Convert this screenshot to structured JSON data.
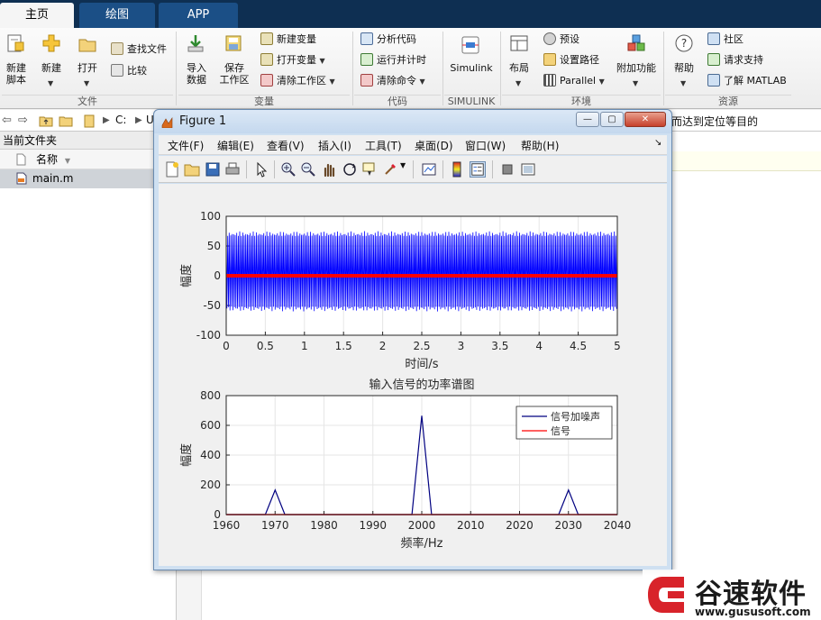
{
  "tabs": [
    {
      "label": "主页",
      "active": true
    },
    {
      "label": "绘图",
      "active": false
    },
    {
      "label": "APP",
      "active": false
    }
  ],
  "ribbon": {
    "file": {
      "new_script": "新建\n脚本",
      "new": "新建",
      "open": "打开",
      "find_files": "查找文件",
      "compare": "比较",
      "group": "文件"
    },
    "variable": {
      "import": "导入\n数据",
      "save_workspace": "保存\n工作区",
      "new_var": "新建变量",
      "open_var": "打开变量",
      "clear_ws": "清除工作区",
      "group": "变量"
    },
    "code": {
      "analyze": "分析代码",
      "run_time": "运行并计时",
      "clear_cmd": "清除命令",
      "group": "代码"
    },
    "simulink": {
      "label": "Simulink",
      "group": "SIMULINK"
    },
    "environment": {
      "layout": "布局",
      "preferences": "预设",
      "set_path": "设置路径",
      "parallel": "Parallel",
      "addons": "附加功能",
      "group": "环境"
    },
    "resources": {
      "help": "帮助",
      "community": "社区",
      "support": "请求支持",
      "learn": "了解 MATLAB",
      "group": "资源"
    }
  },
  "addressbar": {
    "crumb1": "C:",
    "crumb2": "U",
    "tail": "而达到定位等目的"
  },
  "current_folder": {
    "title": "当前文件夹",
    "column_name": "名称",
    "file": "main.m"
  },
  "figure": {
    "title": "Figure 1",
    "menu": [
      "文件(F)",
      "编辑(E)",
      "查看(V)",
      "插入(I)",
      "工具(T)",
      "桌面(D)",
      "窗口(W)",
      "帮助(H)"
    ],
    "buttons": {
      "minimize": "—",
      "maximize": "▢",
      "close": "✕"
    }
  },
  "chart_data": [
    {
      "type": "line",
      "title": "",
      "xlabel": "时间/s",
      "ylabel": "幅度",
      "xlim": [
        0,
        5
      ],
      "ylim": [
        -100,
        100
      ],
      "xticks": [
        "0",
        "0.5",
        "1",
        "1.5",
        "2",
        "2.5",
        "3",
        "3.5",
        "4",
        "4.5",
        "5"
      ],
      "yticks": [
        "100",
        "50",
        "0",
        "-50",
        "-100"
      ],
      "series": [
        {
          "name": "",
          "color": "#0000ff",
          "envelope": [
            -60,
            75
          ],
          "description_note": ""
        },
        {
          "name": "",
          "color": "#ff0000",
          "envelope": [
            -3,
            3
          ]
        }
      ],
      "grid": true
    },
    {
      "type": "line",
      "title": "输入信号的功率谱图",
      "xlabel": "频率/Hz",
      "ylabel": "幅度",
      "xlim": [
        1960,
        2040
      ],
      "ylim": [
        0,
        800
      ],
      "xticks": [
        "1960",
        "1970",
        "1980",
        "1990",
        "2000",
        "2010",
        "2020",
        "2030",
        "2040"
      ],
      "yticks": [
        "800",
        "600",
        "400",
        "200",
        "0"
      ],
      "series": [
        {
          "name": "信号加噪声",
          "color": "#000080",
          "x": [
            1960,
            1968,
            1970,
            1972,
            1998,
            2000,
            2002,
            2028,
            2030,
            2032,
            2040
          ],
          "y": [
            0,
            0,
            165,
            0,
            0,
            665,
            0,
            0,
            165,
            0,
            0
          ]
        },
        {
          "name": "信号",
          "color": "#ff0000",
          "x": [
            1960,
            2040
          ],
          "y": [
            0,
            0
          ]
        }
      ],
      "legend": "top-right",
      "grid": true
    }
  ],
  "watermark": {
    "brand": "谷速软件",
    "url": "www.gususoft.com"
  }
}
